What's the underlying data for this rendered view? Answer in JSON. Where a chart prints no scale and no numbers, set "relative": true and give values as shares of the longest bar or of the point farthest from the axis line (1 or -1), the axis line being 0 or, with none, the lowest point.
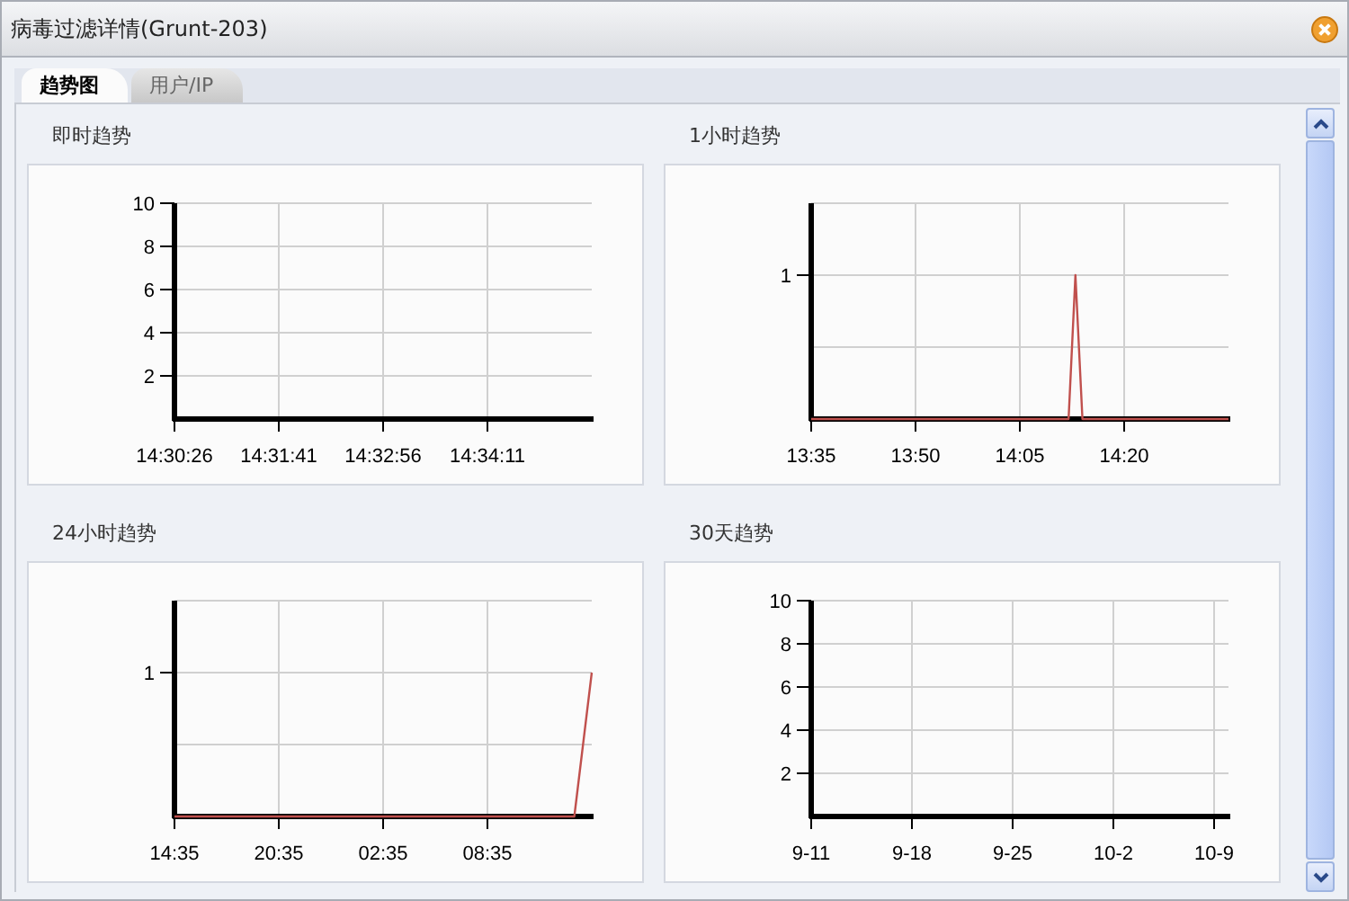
{
  "window": {
    "title": "病毒过滤详情(Grunt-203)"
  },
  "tabs": [
    {
      "label": "趋势图",
      "selected": true
    },
    {
      "label": "用户/IP",
      "selected": false
    }
  ],
  "panels": [
    {
      "title": "即时趋势",
      "chart_data": {
        "type": "line",
        "grid": true,
        "categories": [
          "14:30:26",
          null,
          null,
          null,
          null,
          "14:31:41",
          null,
          null,
          null,
          null,
          "14:32:56",
          null,
          null,
          null,
          null,
          "14:34:11",
          null,
          null,
          null,
          null,
          null
        ],
        "ylim": [
          0,
          10
        ],
        "yticks": [
          2,
          4,
          6,
          8,
          10
        ]
      }
    },
    {
      "title": "1小时趋势",
      "chart_data": {
        "type": "line",
        "relative": true,
        "categories": [
          "13:35",
          null,
          null,
          null,
          null,
          null,
          null,
          null,
          null,
          null,
          null,
          null,
          null,
          null,
          null,
          "13:50",
          null,
          null,
          null,
          null,
          null,
          null,
          null,
          null,
          null,
          null,
          null,
          null,
          null,
          null,
          "14:05",
          null,
          null,
          null,
          null,
          null,
          null,
          null,
          null,
          null,
          null,
          null,
          null,
          null,
          null,
          "14:20",
          null,
          null,
          null,
          null,
          null,
          null,
          null,
          null,
          null,
          null,
          null,
          null,
          null,
          null,
          null
        ],
        "series": [
          {
            "color": "#c0504d",
            "values": [
              0,
              0,
              0,
              0,
              0,
              0,
              0,
              0,
              0,
              0,
              0,
              0,
              0,
              0,
              0,
              0,
              0,
              0,
              0,
              0,
              0,
              0,
              0,
              0,
              0,
              0,
              0,
              0,
              0,
              0,
              0,
              0,
              0,
              0,
              0,
              0,
              0,
              0,
              1,
              0,
              0,
              0,
              0,
              0,
              0,
              0,
              0,
              0,
              0,
              0,
              0,
              0,
              0,
              0,
              0,
              0,
              0,
              0,
              0,
              0,
              0
            ]
          }
        ],
        "annotations": [
          "1"
        ],
        "grid": true
      }
    },
    {
      "title": "24小时趋势",
      "chart_data": {
        "type": "line",
        "relative": true,
        "grid": true,
        "categories": [
          "14:35",
          null,
          null,
          null,
          null,
          null,
          "20:35",
          null,
          null,
          null,
          null,
          null,
          "02:35",
          null,
          null,
          null,
          null,
          null,
          "08:35",
          null,
          null,
          null,
          null,
          null,
          null
        ],
        "series": [
          {
            "color": "#c0504d",
            "values": [
              0,
              0,
              0,
              0,
              0,
              0,
              0,
              0,
              0,
              0,
              0,
              0,
              0,
              0,
              0,
              0,
              0,
              0,
              0,
              0,
              0,
              0,
              0,
              0,
              1
            ]
          }
        ],
        "annotations": [
          "1"
        ]
      }
    },
    {
      "title": "30天趋势",
      "chart_data": {
        "type": "line",
        "grid": true,
        "categories": [
          "9-11",
          null,
          null,
          null,
          null,
          null,
          null,
          "9-18",
          null,
          null,
          null,
          null,
          null,
          null,
          "9-25",
          null,
          null,
          null,
          null,
          null,
          null,
          "10-2",
          null,
          null,
          null,
          null,
          null,
          null,
          "10-9",
          null
        ],
        "ylim": [
          0,
          10
        ],
        "yticks": [
          2,
          4,
          6,
          8,
          10
        ]
      }
    }
  ]
}
